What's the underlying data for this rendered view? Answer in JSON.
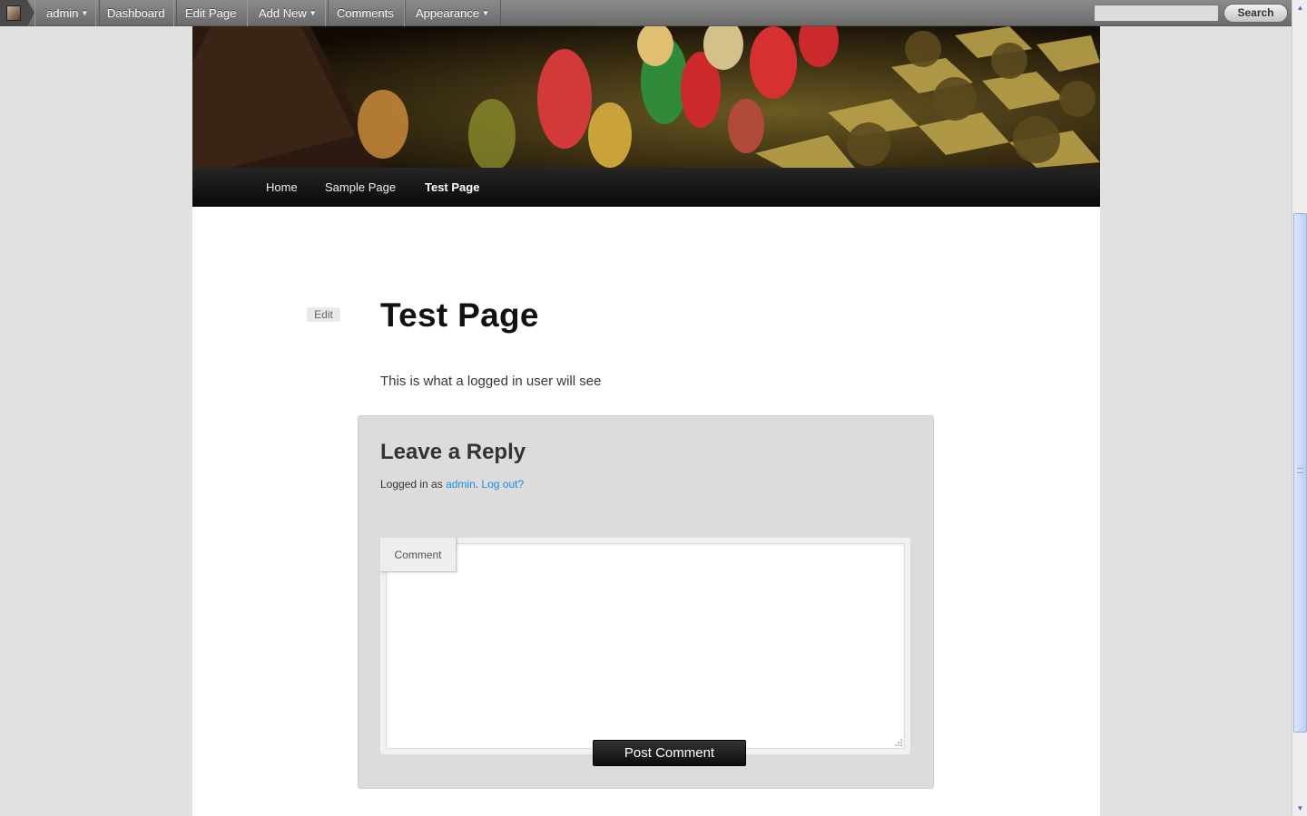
{
  "admin_bar": {
    "items": [
      {
        "label": "admin",
        "has_menu": true
      },
      {
        "label": "Dashboard",
        "has_menu": false
      },
      {
        "label": "Edit Page",
        "has_menu": false
      },
      {
        "label": "Add New",
        "has_menu": true
      },
      {
        "label": "Comments",
        "has_menu": false
      },
      {
        "label": "Appearance",
        "has_menu": true
      }
    ],
    "caret": "▼",
    "search_value": "",
    "search_button": "Search"
  },
  "nav": {
    "items": [
      {
        "label": "Home",
        "current": false
      },
      {
        "label": "Sample Page",
        "current": false
      },
      {
        "label": "Test Page",
        "current": true
      }
    ]
  },
  "post": {
    "edit_label": "Edit",
    "title": "Test Page",
    "content": "This is what a logged in user will see"
  },
  "reply": {
    "title": "Leave a Reply",
    "logged_in_prefix": "Logged in as ",
    "user_link": "admin",
    "separator": ". ",
    "logout_link": "Log out?",
    "comment_label": "Comment",
    "comment_value": "",
    "submit_label": "Post Comment"
  },
  "scrollbar": {
    "up_glyph": "▲",
    "down_glyph": "▼"
  },
  "colors": {
    "link": "#1b8be0",
    "admin_bar": "#7a7a7a",
    "nav_bar": "#1a1a1a",
    "page_bg": "#e1e1e1",
    "reply_box": "#dcdcdc"
  },
  "icons": {
    "site_logo": "admin-avatar-icon",
    "resize": "resize-grip-icon"
  }
}
